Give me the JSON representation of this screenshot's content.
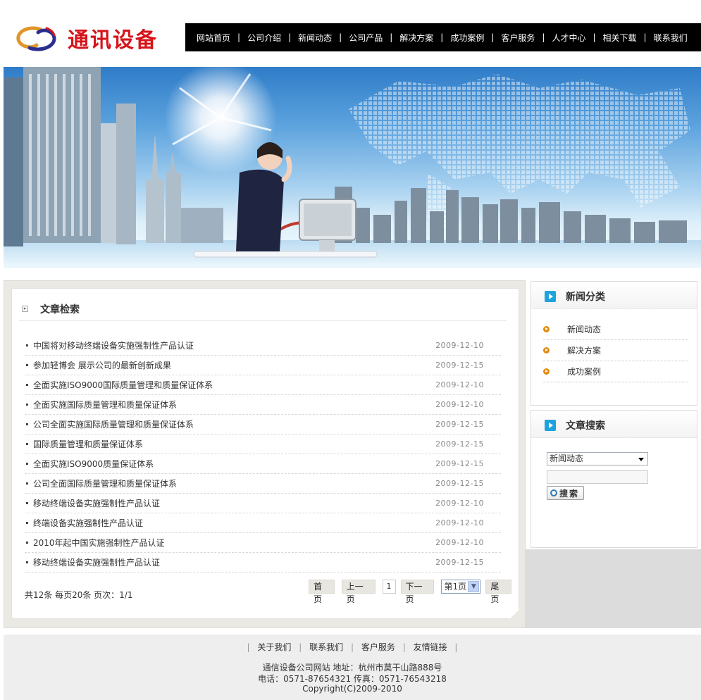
{
  "header": {
    "site_name": "通讯设备"
  },
  "nav": {
    "items": [
      "网站首页",
      "公司介绍",
      "新闻动态",
      "公司产品",
      "解决方案",
      "成功案例",
      "客户服务",
      "人才中心",
      "相关下载",
      "联系我们"
    ],
    "separator": "|"
  },
  "main": {
    "title": "文章检索",
    "articles": [
      {
        "title": "中国将对移动终端设备实施强制性产品认证",
        "date": "2009-12-10"
      },
      {
        "title": "参加轻博会 展示公司的最新创新成果",
        "date": "2009-12-15"
      },
      {
        "title": "全面实施ISO9000国际质量管理和质量保证体系",
        "date": "2009-12-10"
      },
      {
        "title": "全面实施国际质量管理和质量保证体系",
        "date": "2009-12-10"
      },
      {
        "title": "公司全面实施国际质量管理和质量保证体系",
        "date": "2009-12-15"
      },
      {
        "title": "国际质量管理和质量保证体系",
        "date": "2009-12-15"
      },
      {
        "title": "全面实施ISO9000质量保证体系",
        "date": "2009-12-15"
      },
      {
        "title": "公司全面国际质量管理和质量保证体系",
        "date": "2009-12-15"
      },
      {
        "title": "移动终端设备实施强制性产品认证",
        "date": "2009-12-10"
      },
      {
        "title": "终端设备实施强制性产品认证",
        "date": "2009-12-10"
      },
      {
        "title": "2010年起中国实施强制性产品认证",
        "date": "2009-12-10"
      },
      {
        "title": "移动终端设备实施强制性产品认证",
        "date": "2009-12-15"
      }
    ],
    "summary": "共12条  每页20条  页次：1/1",
    "pager": {
      "first": "首页",
      "prev": "上一页",
      "current": "1",
      "next": "下一页",
      "select_value": "第1页",
      "last": "尾页"
    }
  },
  "sidebar": {
    "categories_title": "新闻分类",
    "categories": [
      "新闻动态",
      "解决方案",
      "成功案例"
    ],
    "search_title": "文章搜索",
    "search_select_value": "新闻动态",
    "search_input_value": "",
    "search_button": "搜索"
  },
  "footer": {
    "links": [
      "关于我们",
      "联系我们",
      "客户服务",
      "友情链接"
    ],
    "separator": "|",
    "line1": "通信设备公司网站  地址：杭州市莫干山路888号",
    "line2": "电话：0571-87654321   传真：0571-76543218",
    "line3": "Copyright(C)2009-2010"
  },
  "colors": {
    "brand_red": "#d6141b",
    "nav_bg": "#000000",
    "accent_blue": "#1fa3dc",
    "accent_orange": "#e08a14"
  }
}
